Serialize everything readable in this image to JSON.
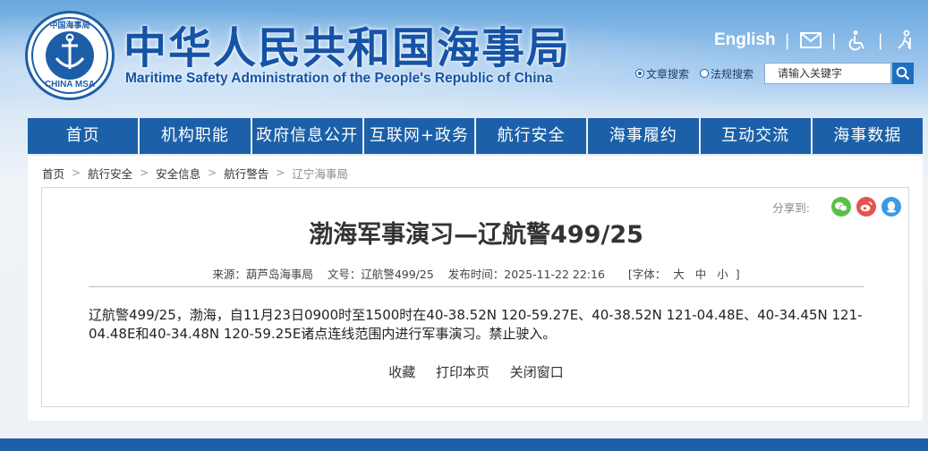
{
  "header": {
    "title": "中华人民共和国海事局",
    "subtitle": "Maritime Safety Administration of the People's Republic of China",
    "logo": {
      "top_text": "中国海事局",
      "bottom_text": "CHINA MSA"
    },
    "english_link": "English",
    "icons": [
      "mail-icon",
      "accessibility-icon",
      "elderly-care-icon"
    ],
    "search": {
      "options": [
        {
          "label": "文章搜索",
          "selected": true
        },
        {
          "label": "法规搜索",
          "selected": false
        }
      ],
      "placeholder": "请输入关键字"
    }
  },
  "nav": {
    "items": [
      "首页",
      "机构职能",
      "政府信息公开",
      "互联网+政务",
      "航行安全",
      "海事履约",
      "互动交流",
      "海事数据"
    ]
  },
  "breadcrumb": [
    "首页",
    "航行安全",
    "安全信息",
    "航行警告",
    "辽宁海事局"
  ],
  "share": {
    "label": "分享到:",
    "services": [
      "wechat-icon",
      "weibo-icon",
      "qq-icon"
    ]
  },
  "article": {
    "title": "渤海军事演习—辽航警499/25",
    "meta": {
      "source": "来源：葫芦岛海事局",
      "doc_no": "文号：辽航警499/25",
      "published": "发布时间：2025-11-22 22:16",
      "font_label": "[字体：",
      "font_large": "大",
      "font_medium": "中",
      "font_small": "小",
      "font_end": "]"
    },
    "body": "辽航警499/25，渤海，自11月23日0900时至1500时在40-38.52N 120-59.27E、40-38.52N 121-04.48E、40-34.45N 121-04.48E和40-34.48N 120-59.25E诸点连线范围内进行军事演习。禁止驶入。",
    "actions": [
      "收藏",
      "打印本页",
      "关闭窗口"
    ]
  },
  "colors": {
    "brand_blue": "#1b60a8",
    "title_blue": "#1553a6"
  }
}
